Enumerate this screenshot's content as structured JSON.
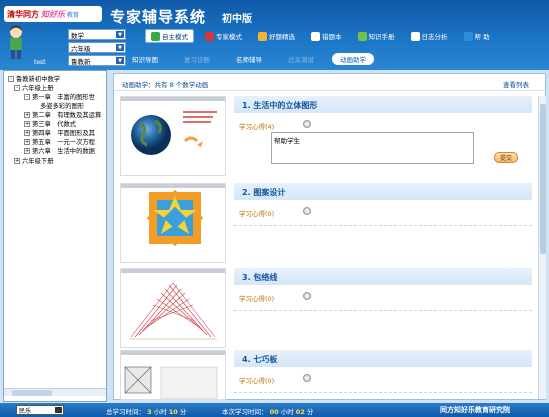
{
  "brand": {
    "part1": "清华同方",
    "part2": "知好乐",
    "part3": "教育"
  },
  "header": {
    "title": "专家辅导系统",
    "edition": "初中版"
  },
  "user": {
    "name": "test"
  },
  "selectors": {
    "subject": "数学",
    "grade": "六年级",
    "edition": "鲁教新"
  },
  "toolbar": [
    {
      "label": "自主模式",
      "icon": "mode-icon",
      "color": "#38a848",
      "active": true
    },
    {
      "label": "专家模式",
      "icon": "expert-icon",
      "color": "#d23a3a",
      "active": false
    },
    {
      "label": "好题精选",
      "icon": "star-icon",
      "color": "#f2b233",
      "active": false
    },
    {
      "label": "错题本",
      "icon": "book-icon",
      "color": "#ffffff",
      "active": false
    },
    {
      "label": "知识手册",
      "icon": "handbook-icon",
      "color": "#6fc34a",
      "active": false
    },
    {
      "label": "日志分析",
      "icon": "log-icon",
      "color": "#ffffff",
      "active": false
    },
    {
      "label": "帮 助",
      "icon": "help-icon",
      "color": "#2b8fe0",
      "active": false
    }
  ],
  "tabs": [
    {
      "label": "知识导图",
      "state": "normal"
    },
    {
      "label": "复习诊断",
      "state": "dim"
    },
    {
      "label": "名师辅导",
      "state": "normal"
    },
    {
      "label": "过关测试",
      "state": "dim"
    },
    {
      "label": "动画助学",
      "state": "active"
    }
  ],
  "tree": [
    {
      "label": "鲁教新初中数学",
      "toggle": "-"
    },
    {
      "label": "六年级上册",
      "toggle": "-"
    },
    {
      "label": "第一章　丰富的图形世",
      "toggle": "-"
    },
    {
      "label": "多姿多彩的图形",
      "toggle": ""
    },
    {
      "label": "第二章　有理数及其运算",
      "toggle": "+"
    },
    {
      "label": "第三章　代数式",
      "toggle": "+"
    },
    {
      "label": "第四章　平面图形及其",
      "toggle": "+"
    },
    {
      "label": "第五章　一元一次方程",
      "toggle": "+"
    },
    {
      "label": "第六章　生活中的数据",
      "toggle": "+"
    },
    {
      "label": "六年级下册",
      "toggle": "+"
    }
  ],
  "main": {
    "count_text": "动画助学：共有 8 个数学动画",
    "view_list": "查看列表"
  },
  "lessons": [
    {
      "title": "1. 生活中的立体图形",
      "note_label": "学习心得(4)"
    },
    {
      "title": "2. 图案设计",
      "note_label": "学习心得(0)"
    },
    {
      "title": "3. 包络线",
      "note_label": "学习心得(0)"
    },
    {
      "title": "4. 七巧板",
      "note_label": "学习心得(0)"
    }
  ],
  "note": {
    "text": "帮助学生",
    "submit": "提交"
  },
  "status": {
    "font": "民乐",
    "total_label": "总学习时间：",
    "total_hours": "3",
    "hours_unit": "小时",
    "total_minutes": "10",
    "min_unit": "分",
    "session_label": "本次学习时间：",
    "session_hours": "00",
    "session_minutes": "02",
    "footer_brand": "同方知好乐教育研究院"
  }
}
